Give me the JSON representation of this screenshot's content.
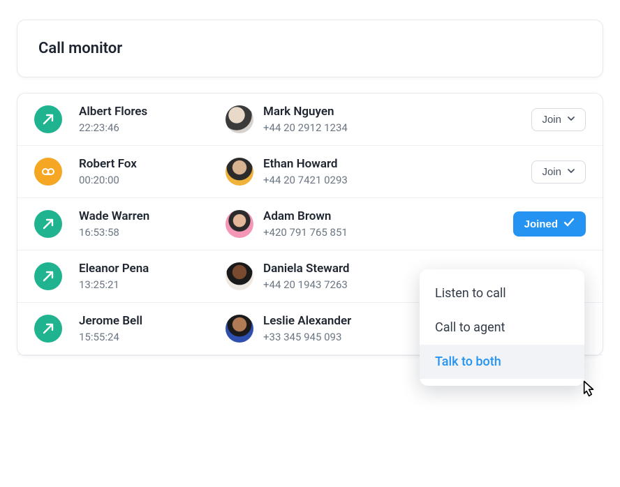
{
  "header": {
    "title": "Call monitor"
  },
  "rows": [
    {
      "statusIcon": "outbound",
      "agentName": "Albert Flores",
      "time": "22:23:46",
      "avatarClass": "av-a",
      "contactName": "Mark Nguyen",
      "contactPhone": "+44 20 2912 1234",
      "action": "join"
    },
    {
      "statusIcon": "voicemail",
      "agentName": "Robert Fox",
      "time": "00:20:00",
      "avatarClass": "av-b",
      "contactName": "Ethan Howard",
      "contactPhone": "+44 20 7421 0293",
      "action": "join"
    },
    {
      "statusIcon": "outbound",
      "agentName": "Wade Warren",
      "time": "16:53:58",
      "avatarClass": "av-c",
      "contactName": "Adam Brown",
      "contactPhone": "+420 791 765 851",
      "action": "joined"
    },
    {
      "statusIcon": "outbound",
      "agentName": "Eleanor Pena",
      "time": "13:25:21",
      "avatarClass": "av-d",
      "contactName": "Daniela Steward",
      "contactPhone": "+44 20 1943 7263",
      "action": "none"
    },
    {
      "statusIcon": "outbound",
      "agentName": "Jerome Bell",
      "time": "15:55:24",
      "avatarClass": "av-e",
      "contactName": "Leslie Alexander",
      "contactPhone": "+33 345 945 093",
      "action": "none"
    }
  ],
  "buttons": {
    "joinLabel": "Join",
    "joinedLabel": "Joined"
  },
  "dropdown": {
    "items": [
      {
        "label": "Listen to call",
        "active": false
      },
      {
        "label": "Call to agent",
        "active": false
      },
      {
        "label": "Talk to both",
        "active": true
      }
    ]
  }
}
